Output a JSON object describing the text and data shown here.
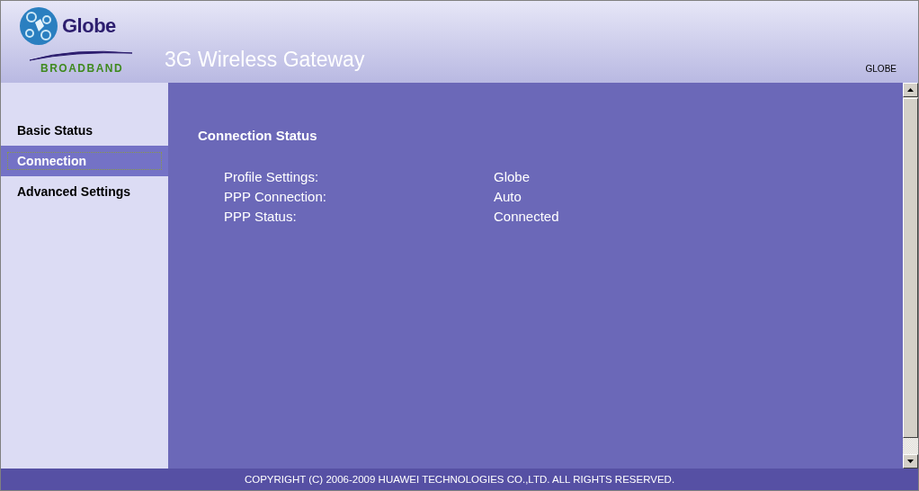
{
  "header": {
    "brand": "Globe",
    "tagline": "BROADBAND",
    "title": "3G Wireless Gateway",
    "operator": "GLOBE"
  },
  "sidebar": {
    "items": [
      {
        "label": "Basic Status",
        "selected": false
      },
      {
        "label": "Connection",
        "selected": true
      },
      {
        "label": "Advanced Settings",
        "selected": false
      }
    ]
  },
  "content": {
    "heading": "Connection Status",
    "rows": [
      {
        "label": "Profile Settings:",
        "value": "Globe"
      },
      {
        "label": "PPP Connection:",
        "value": "Auto"
      },
      {
        "label": "PPP Status:",
        "value": "Connected"
      }
    ]
  },
  "footer": "COPYRIGHT (C) 2006-2009 HUAWEI TECHNOLOGIES CO.,LTD. ALL RIGHTS RESERVED."
}
